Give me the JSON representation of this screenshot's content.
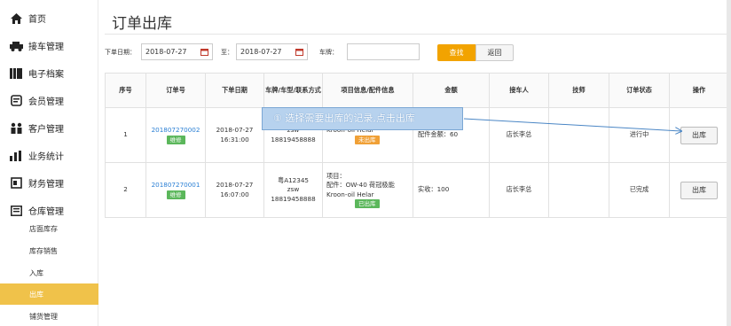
{
  "sidebar": {
    "items": [
      {
        "label": "首页",
        "icon": "home-icon"
      },
      {
        "label": "接车管理",
        "icon": "car-icon"
      },
      {
        "label": "电子档案",
        "icon": "archive-icon"
      },
      {
        "label": "会员管理",
        "icon": "member-icon"
      },
      {
        "label": "客户管理",
        "icon": "customers-icon"
      },
      {
        "label": "业务统计",
        "icon": "bar-chart-icon"
      },
      {
        "label": "财务管理",
        "icon": "finance-icon"
      },
      {
        "label": "仓库管理",
        "icon": "warehouse-icon"
      }
    ],
    "subitems": [
      {
        "label": "店面库存",
        "active": false
      },
      {
        "label": "库存销售",
        "active": false
      },
      {
        "label": "入库",
        "active": false
      },
      {
        "label": "出库",
        "active": true
      },
      {
        "label": "铺货管理",
        "active": false
      }
    ],
    "active_color": "#f0c24a"
  },
  "page": {
    "title": "订单出库"
  },
  "filters": {
    "order_date_label": "下单日期：",
    "date_from": "2018-07-27",
    "to_label": "至：",
    "date_to": "2018-07-27",
    "plate_label": "车牌：",
    "plate_value": "",
    "search_label": "查找",
    "back_label": "返回",
    "search_color": "#f2a300"
  },
  "table": {
    "headers": [
      "序号",
      "订单号",
      "下单日期",
      "车牌/车型/联系方式",
      "项目信息/配件信息",
      "金额",
      "接车人",
      "技师",
      "订单状态",
      "操作"
    ],
    "rows": [
      {
        "index": "1",
        "order_no": "201807270002",
        "type_tag": "维修",
        "date": "2018-07-27",
        "time": "16:31:00",
        "plate": "",
        "car_model": "zsw",
        "phone": "18819458888",
        "info_label": "",
        "part": "",
        "brand": "Kroon-oil Helar",
        "stock_tag": "未出库",
        "amount": "配件金额：60",
        "receiver": "店长李总",
        "technician": "",
        "status": "进行中",
        "action": "出库"
      },
      {
        "index": "2",
        "order_no": "201807270001",
        "type_tag": "维修",
        "date": "2018-07-27",
        "time": "16:07:00",
        "plate": "粤A12345",
        "car_model": "zsw",
        "phone": "18819458888",
        "info_label": "项目：",
        "part": "配件：OW-40 荷冠极能",
        "brand": "Kroon-oil Helar",
        "stock_tag": "已出库",
        "amount": "实收：100",
        "receiver": "店长李总",
        "technician": "",
        "status": "已完成",
        "action": "出库"
      }
    ]
  },
  "callout": {
    "text": "① 选择需要出库的记录,点击出库"
  }
}
